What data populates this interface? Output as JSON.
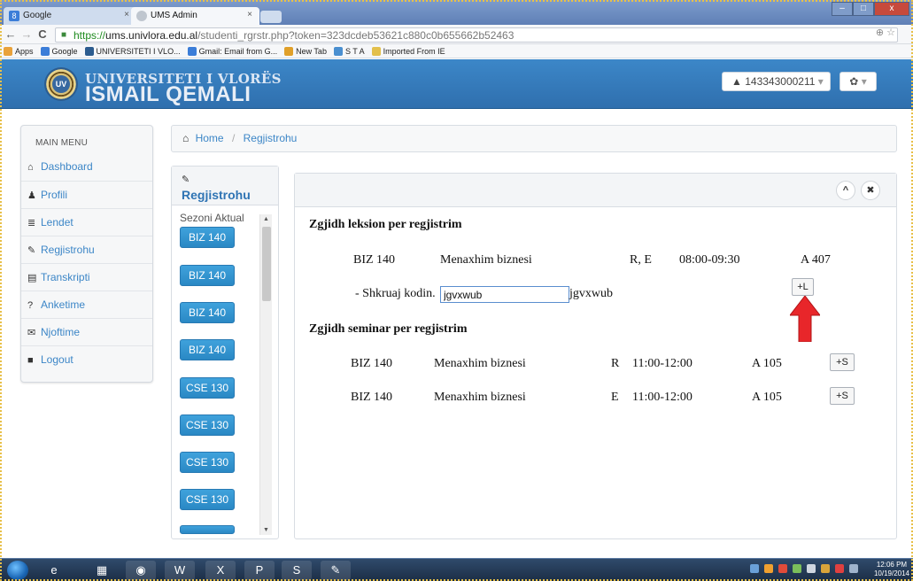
{
  "browser": {
    "tabs": [
      {
        "label": "Google",
        "close": "×"
      },
      {
        "label": "UMS Admin",
        "close": "×"
      }
    ],
    "window_buttons": {
      "minimize": "–",
      "maximize": "□",
      "close": "x"
    },
    "nav": {
      "back": "←",
      "forward": "→",
      "reload": "C"
    },
    "url": {
      "scheme": "https://",
      "host": "ums.univlora.edu.al",
      "path": "/studenti_rgrstr.php?token=323dcdeb53621c880c0b655662b52463"
    },
    "bookmarks": [
      {
        "label": "Apps",
        "icon": "apps-icon",
        "color": "#e9a23b"
      },
      {
        "label": "Google",
        "icon": "google-icon",
        "color": "#3b7dd8"
      },
      {
        "label": "UNIVERSITETI I VLO...",
        "icon": "uv-icon",
        "color": "#2c5c8f"
      },
      {
        "label": "Gmail: Email from G...",
        "icon": "google-icon",
        "color": "#3b7dd8"
      },
      {
        "label": "New Tab",
        "icon": "download-icon",
        "color": "#e0a02a"
      },
      {
        "label": "S T A",
        "icon": "check-icon",
        "color": "#4a8fd0"
      },
      {
        "label": "Imported From IE",
        "icon": "folder-icon",
        "color": "#e3c04c"
      }
    ]
  },
  "header": {
    "brand_line1": "UNIVERSITETI I VLORËS",
    "brand_line2": "ISMAIL QEMALI",
    "logo_text": "UV",
    "user_id": "143343000211",
    "user_icon": "▲",
    "gear_icon": "✿",
    "caret": "▾",
    "accent": "#2f74b4"
  },
  "sidebar": {
    "title": "MAIN MENU",
    "items": [
      {
        "label": "Dashboard",
        "icon": "home-icon",
        "glyph": "⌂"
      },
      {
        "label": "Profili",
        "icon": "user-icon",
        "glyph": "♟"
      },
      {
        "label": "Lendet",
        "icon": "list-icon",
        "glyph": "≣"
      },
      {
        "label": "Regjistrohu",
        "icon": "edit-icon",
        "glyph": "✎"
      },
      {
        "label": "Transkripti",
        "icon": "document-icon",
        "glyph": "▤"
      },
      {
        "label": "Anketime",
        "icon": "question-icon",
        "glyph": "?"
      },
      {
        "label": "Njoftime",
        "icon": "envelope-icon",
        "glyph": "✉"
      },
      {
        "label": "Logout",
        "icon": "lock-icon",
        "glyph": "■"
      }
    ]
  },
  "breadcrumb": {
    "home": "Home",
    "current": "Regjistrohu",
    "home_glyph": "⌂",
    "separator": "/"
  },
  "reg_panel": {
    "icon_glyph": "✎",
    "title": "Regjistrohu",
    "season": "Sezoni Aktual",
    "courses": [
      "BIZ 140",
      "BIZ 140",
      "BIZ 140",
      "BIZ 140",
      "CSE 130",
      "CSE 130",
      "CSE 130",
      "CSE 130"
    ]
  },
  "main": {
    "collapse_glyph": "^",
    "close_glyph": "✖",
    "lecture_heading": "Zgjidh leksion per regjistrim",
    "lecture": {
      "code": "BIZ 140",
      "name": "Menaxhim biznesi",
      "days": "R, E",
      "time": "08:00-09:30",
      "room": "A 407"
    },
    "code_label": "- Shkruaj kodin.",
    "code_value": "jgvxwub",
    "code_echo": "jgvxwub",
    "add_lecture_label": "+L",
    "seminar_heading": "Zgjidh seminar per regjistrim",
    "seminars": [
      {
        "code": "BIZ 140",
        "name": "Menaxhim biznesi",
        "day": "R",
        "time": "11:00-12:00",
        "room": "A 105",
        "button": "+S"
      },
      {
        "code": "BIZ 140",
        "name": "Menaxhim biznesi",
        "day": "E",
        "time": "11:00-12:00",
        "room": "A 105",
        "button": "+S"
      }
    ]
  },
  "annotation_color": "#e8262a",
  "taskbar": {
    "apps": [
      {
        "icon": "ie-icon",
        "glyph": "e"
      },
      {
        "icon": "explorer-icon",
        "glyph": "▦"
      },
      {
        "icon": "chrome-icon",
        "glyph": "◉"
      },
      {
        "icon": "word-icon",
        "glyph": "W"
      },
      {
        "icon": "excel-icon",
        "glyph": "X"
      },
      {
        "icon": "powerpoint-icon",
        "glyph": "P"
      },
      {
        "icon": "skype-icon",
        "glyph": "S"
      },
      {
        "icon": "paint-icon",
        "glyph": "✎"
      }
    ],
    "time": "12:06 PM",
    "date": "10/19/2014"
  }
}
